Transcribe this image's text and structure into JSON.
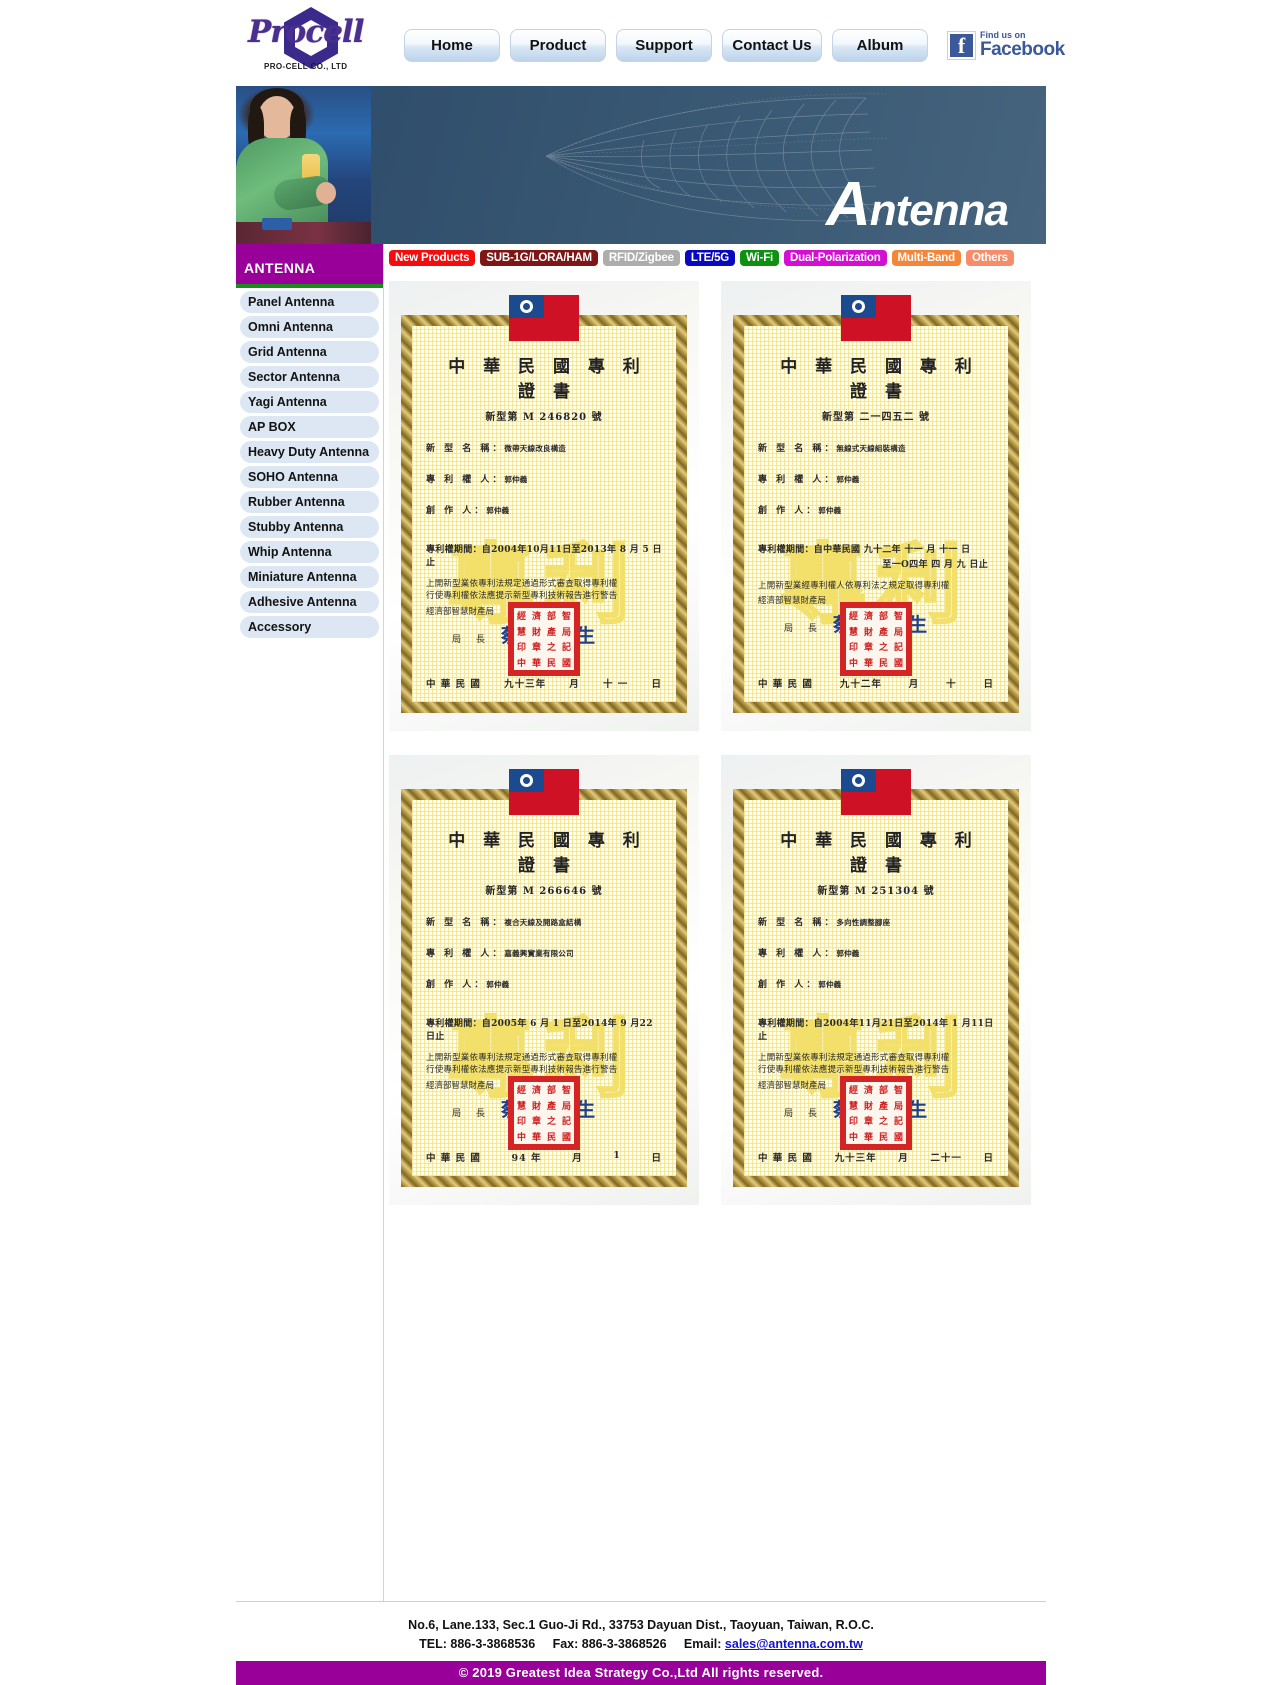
{
  "brand": {
    "logo_text": "Procell",
    "logo_sub": "PRO-CELL CO., LTD"
  },
  "nav": {
    "items": [
      {
        "label": "Home"
      },
      {
        "label": "Product"
      },
      {
        "label": "Support"
      },
      {
        "label": "Contact Us"
      },
      {
        "label": "Album"
      }
    ],
    "facebook": {
      "line1": "Find us on",
      "line2": "Facebook",
      "glyph": "f"
    }
  },
  "banner": {
    "title_cap": "A",
    "title_rest": "ntenna"
  },
  "sidebar": {
    "header": "ANTENNA",
    "header_color": "#990099",
    "accent_color": "#1a8c1a",
    "items": [
      {
        "label": "Panel Antenna"
      },
      {
        "label": "Omni Antenna"
      },
      {
        "label": "Grid Antenna"
      },
      {
        "label": "Sector Antenna"
      },
      {
        "label": "Yagi Antenna"
      },
      {
        "label": "AP BOX"
      },
      {
        "label": "Heavy Duty Antenna"
      },
      {
        "label": "SOHO Antenna"
      },
      {
        "label": "Rubber Antenna"
      },
      {
        "label": "Stubby Antenna"
      },
      {
        "label": "Whip Antenna"
      },
      {
        "label": "Miniature Antenna"
      },
      {
        "label": "Adhesive Antenna"
      },
      {
        "label": "Accessory"
      }
    ]
  },
  "tabs": [
    {
      "label": "New Products",
      "color": "#f50d0d"
    },
    {
      "label": "SUB-1G/LORA/HAM",
      "color": "#7e1616"
    },
    {
      "label": "RFID/Zigbee",
      "color": "#adadad"
    },
    {
      "label": "LTE/5G",
      "color": "#0808c0"
    },
    {
      "label": "Wi-Fi",
      "color": "#0e9110"
    },
    {
      "label": "Dual-Polarization",
      "color": "#d40fd4"
    },
    {
      "label": "Multi-Band",
      "color": "#f4863a"
    },
    {
      "label": "Others",
      "color": "#f58c6a"
    }
  ],
  "certificates": [
    {
      "flag_alt": "Republic of China flag",
      "title": "中 華 民 國 專 利 證 書",
      "number": "新型第  M    246820   號",
      "name_label": "新 型 名 稱：",
      "name_value": "微帶天線改良構造",
      "holder_label": "專 利 權 人：",
      "holder_value": "郭仲義",
      "creator_label": "創  作  人：",
      "creator_value": "郭仲義",
      "term_line1": "專利權期間：自2004年10月11日至2013年 8 月 5 日止",
      "term_line2": "",
      "note_line1": "上開新型業依專利法規定通過形式審查取得專利權",
      "note_line2": "行使專利權依法應提示新型專利技術報告進行警告",
      "office": "經濟部智慧財產局",
      "sign_label": "局      長",
      "sign_name": "蔡 練 生",
      "seal_chars": [
        "經",
        "濟",
        "部",
        "智",
        "慧",
        "財",
        "產",
        "局",
        "印",
        "章",
        "之",
        "記",
        "中",
        "華",
        "民",
        "國"
      ],
      "date_left": "中 華 民 國",
      "date_year": "九十三年",
      "date_month": "月",
      "date_day": "十 一",
      "date_suffix": "日"
    },
    {
      "flag_alt": "Republic of China flag",
      "title": "中 華 民 國 專 利 證 書",
      "number": "新型第   二一四五二  號",
      "name_label": "新 型 名 稱：",
      "name_value": "無線式天線組裝構造",
      "holder_label": "專 利 權 人：",
      "holder_value": "郭仲義",
      "creator_label": "創  作  人：",
      "creator_value": "郭仲義",
      "term_line1": "專利權期間：自中華民國 九十二年 十一 月 十一 日",
      "term_line2": "至一O四年  四  月  九  日止",
      "note_line1": "上開新型業經專利權人依專利法之規定取得專利權",
      "note_line2": "",
      "office": "經濟部智慧財產局",
      "sign_label": "局      長",
      "sign_name": "蔡 練 生",
      "seal_chars": [
        "經",
        "濟",
        "部",
        "智",
        "慧",
        "財",
        "產",
        "局",
        "印",
        "章",
        "之",
        "記",
        "中",
        "華",
        "民",
        "國"
      ],
      "date_left": "中 華 民 國",
      "date_year": "九十二年",
      "date_month": "月",
      "date_day": "十",
      "date_suffix": "日"
    },
    {
      "flag_alt": "Republic of China flag",
      "title": "中 華 民 國 專 利 證 書",
      "number": "新型第  M    266646   號",
      "name_label": "新 型 名 稱：",
      "name_value": "複合天線及開路盒結構",
      "holder_label": "專 利 權 人：",
      "holder_value": "嘉義興實業有限公司",
      "creator_label": "創  作  人：",
      "creator_value": "郭仲義",
      "term_line1": "專利權期間：自2005年 6 月 1 日至2014年 9 月22日止",
      "term_line2": "",
      "note_line1": "上開新型業依專利法規定通過形式審查取得專利權",
      "note_line2": "行使專利權依法應提示新型專利技術報告進行警告",
      "office": "經濟部智慧財產局",
      "sign_label": "局      長",
      "sign_name": "蔡 練 生",
      "seal_chars": [
        "經",
        "濟",
        "部",
        "智",
        "慧",
        "財",
        "產",
        "局",
        "印",
        "章",
        "之",
        "記",
        "中",
        "華",
        "民",
        "國"
      ],
      "date_left": "中 華 民 國",
      "date_year": "94 年",
      "date_month": "月",
      "date_day": "1",
      "date_suffix": "日"
    },
    {
      "flag_alt": "Republic of China flag",
      "title": "中 華 民 國 專 利 證 書",
      "number": "新型第  M    251304   號",
      "name_label": "新 型 名 稱：",
      "name_value": "多向性調整腳座",
      "holder_label": "專 利 權 人：",
      "holder_value": "郭仲義",
      "creator_label": "創  作  人：",
      "creator_value": "郭仲義",
      "term_line1": "專利權期間：自2004年11月21日至2014年 1 月11日止",
      "term_line2": "",
      "note_line1": "上開新型業依專利法規定通過形式審查取得專利權",
      "note_line2": "行使專利權依法應提示新型專利技術報告進行警告",
      "office": "經濟部智慧財產局",
      "sign_label": "局      長",
      "sign_name": "蔡 練 生",
      "seal_chars": [
        "經",
        "濟",
        "部",
        "智",
        "慧",
        "財",
        "產",
        "局",
        "印",
        "章",
        "之",
        "記",
        "中",
        "華",
        "民",
        "國"
      ],
      "date_left": "中 華 民 國",
      "date_year": "九十三年",
      "date_month": "月",
      "date_day": "二十一",
      "date_suffix": "日"
    }
  ],
  "footer": {
    "address": "No.6, Lane.133, Sec.1 Guo-Ji Rd., 33753 Dayuan Dist., Taoyuan, Taiwan, R.O.C.",
    "tel_label": "TEL: 886-3-3868536",
    "fax_label": "Fax: 886-3-3868526",
    "email_label": "Email:",
    "email": "sales@antenna.com.tw",
    "copyright": "© 2019 Greatest Idea Strategy Co.,Ltd All rights reserved."
  }
}
